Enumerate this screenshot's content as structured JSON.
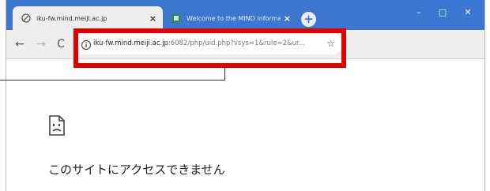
{
  "browser": {
    "tabs": [
      {
        "title": "iku-fw.mind.meiji.ac.jp",
        "close": "×",
        "favicon": "globe-icon",
        "active": true
      },
      {
        "title": "Welcome to the MIND Informati",
        "close": "×",
        "favicon": "site-favicon-icon",
        "active": false
      }
    ],
    "new_tab": "+",
    "window_controls": {
      "minimize": "–",
      "maximize": "□",
      "close": "✕"
    },
    "nav": {
      "back": "←",
      "forward": "→",
      "reload": "C"
    },
    "address_bar": {
      "info_icon": "info-icon",
      "url_host": "iku-fw.mind.meiji.ac.jp",
      "url_rest": ":6082/php/uid.php?vsys=1&rule=2&ur...",
      "bookmark": "☆"
    }
  },
  "page": {
    "error_icon": "sad-page-icon",
    "error_message": "このサイトにアクセスできません"
  },
  "annotation": {
    "highlight_color": "#e00000"
  },
  "colors": {
    "titlebar": "#3c76cf",
    "toolbar": "#eeeeee"
  }
}
